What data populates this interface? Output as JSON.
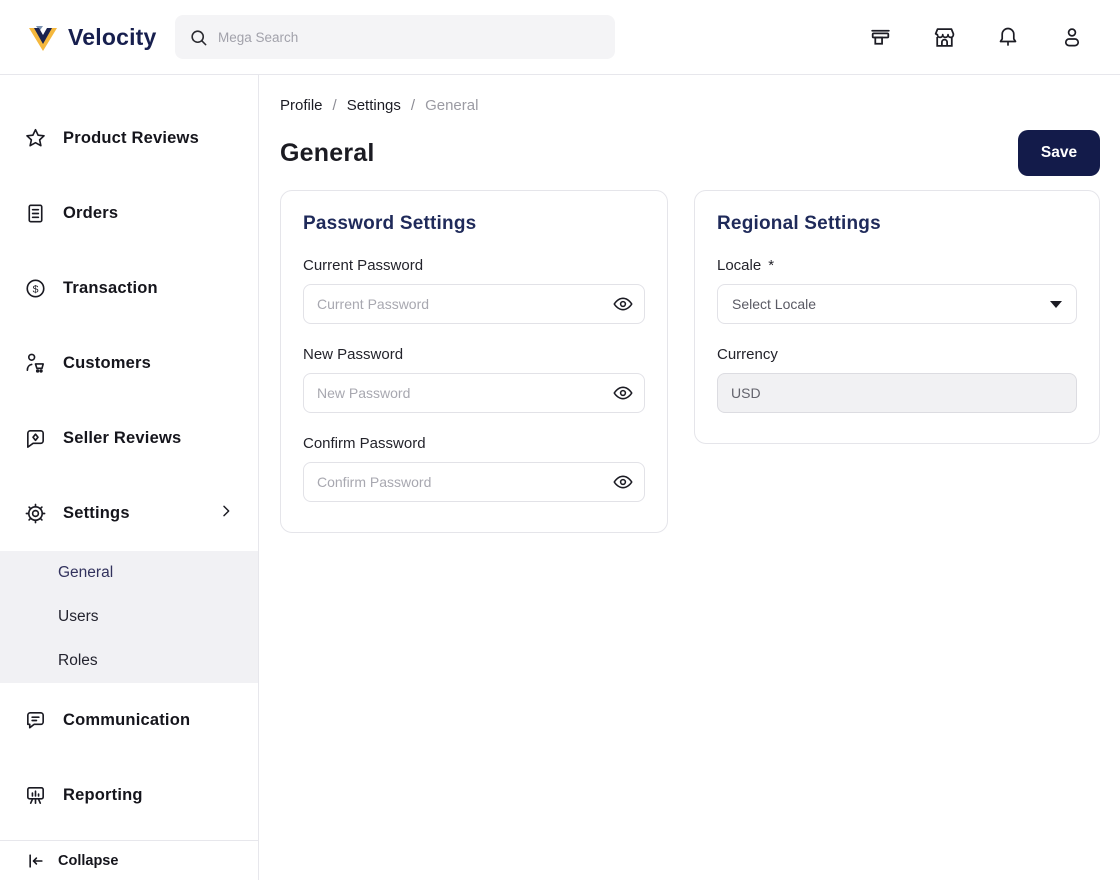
{
  "header": {
    "brand": "Velocity",
    "search": {
      "placeholder": "Mega Search"
    },
    "icons": [
      "counter-icon",
      "storefront-icon",
      "bell-icon",
      "account-icon"
    ]
  },
  "sidebar": {
    "items": [
      {
        "label": "Product Reviews",
        "icon": "star-icon"
      },
      {
        "label": "Orders",
        "icon": "orders-icon"
      },
      {
        "label": "Transaction",
        "icon": "dollar-circle-icon"
      },
      {
        "label": "Customers",
        "icon": "customer-cart-icon"
      },
      {
        "label": "Seller Reviews",
        "icon": "review-bubble-icon"
      },
      {
        "label": "Settings",
        "icon": "gear-icon",
        "expanded": true
      }
    ],
    "settings_submenu": [
      {
        "label": "General",
        "active": true
      },
      {
        "label": "Users",
        "active": false
      },
      {
        "label": "Roles",
        "active": false
      }
    ],
    "items_bottom": [
      {
        "label": "Communication",
        "icon": "chat-bubble-icon"
      },
      {
        "label": "Reporting",
        "icon": "presentation-chart-icon"
      }
    ],
    "collapse": {
      "label": "Collapse",
      "icon": "collapse-left-icon"
    }
  },
  "breadcrumb": {
    "separator": "/",
    "items": [
      {
        "label": "Profile"
      },
      {
        "label": "Settings"
      },
      {
        "label": "General",
        "current": true
      }
    ]
  },
  "page": {
    "title": "General",
    "save_label": "Save"
  },
  "cards": {
    "password": {
      "title": "Password Settings",
      "fields": [
        {
          "label": "Current Password",
          "placeholder": "Current Password"
        },
        {
          "label": "New Password",
          "placeholder": "New Password"
        },
        {
          "label": "Confirm Password",
          "placeholder": "Confirm Password"
        }
      ]
    },
    "regional": {
      "title": "Regional Settings",
      "locale_label": "Locale",
      "locale_required_mark": "*",
      "locale_placeholder": "Select Locale",
      "currency_label": "Currency",
      "currency_value": "USD"
    }
  },
  "colors": {
    "navy": "#131b4a",
    "card_title_navy": "#1f2a5a",
    "brand_gold": "#f5b83d",
    "brand_blue_gray": "#7d93b2",
    "subnav_bg": "#f1f1f4",
    "border": "#e5e5ea"
  }
}
